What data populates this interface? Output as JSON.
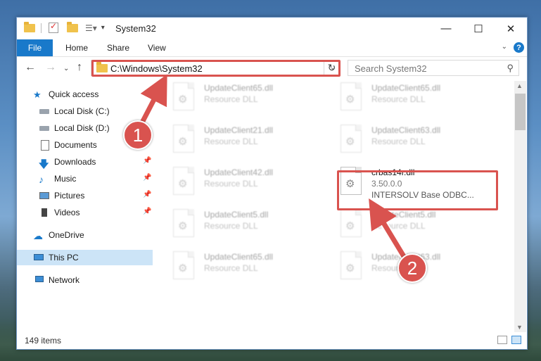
{
  "window": {
    "title": "System32",
    "controls": {
      "minimize": "—",
      "maximize": "☐",
      "close": "✕"
    }
  },
  "ribbon": {
    "tabs": [
      "File",
      "Home",
      "Share",
      "View"
    ],
    "help": "?"
  },
  "nav": {
    "address": "C:\\Windows\\System32",
    "search_placeholder": "Search System32"
  },
  "sidebar": {
    "items": [
      {
        "label": "Quick access",
        "icon": "star-icon"
      },
      {
        "label": "Local Disk (C:)",
        "icon": "drive-icon"
      },
      {
        "label": "Local Disk (D:)",
        "icon": "drive-icon"
      },
      {
        "label": "Documents",
        "icon": "documents-icon"
      },
      {
        "label": "Downloads",
        "icon": "download-icon"
      },
      {
        "label": "Music",
        "icon": "music-icon"
      },
      {
        "label": "Pictures",
        "icon": "pictures-icon"
      },
      {
        "label": "Videos",
        "icon": "videos-icon"
      },
      {
        "label": "OneDrive",
        "icon": "cloud-icon"
      },
      {
        "label": "This PC",
        "icon": "computer-icon"
      },
      {
        "label": "Network",
        "icon": "network-icon"
      }
    ]
  },
  "files": {
    "left": [
      {
        "name": "UpdateClient65.dll",
        "desc": "Resource DLL"
      },
      {
        "name": "UpdateClient21.dll",
        "desc": "Resource DLL"
      },
      {
        "name": "UpdateClient42.dll",
        "desc": "Resource DLL"
      },
      {
        "name": "UpdateClient5.dll",
        "desc": "Resource DLL"
      },
      {
        "name": "UpdateClient65.dll",
        "desc": "Resource DLL"
      }
    ],
    "right": [
      {
        "name": "UpdateClient65.dll",
        "desc": "Resource DLL"
      },
      {
        "name": "UpdateClient63.dll",
        "desc": "Resource DLL"
      },
      {
        "name": "UpdateClient5.dll",
        "desc": "Resource DLL"
      },
      {
        "name": "UpdateClient63.dll",
        "desc": "Resource DLL"
      }
    ],
    "highlighted": {
      "name": "crbas14r.dll",
      "version": "3.50.0.0",
      "desc": "INTERSOLV Base ODBC..."
    }
  },
  "status": {
    "count": "149 items"
  },
  "annotations": {
    "step1": "1",
    "step2": "2",
    "color": "#d9534f"
  }
}
